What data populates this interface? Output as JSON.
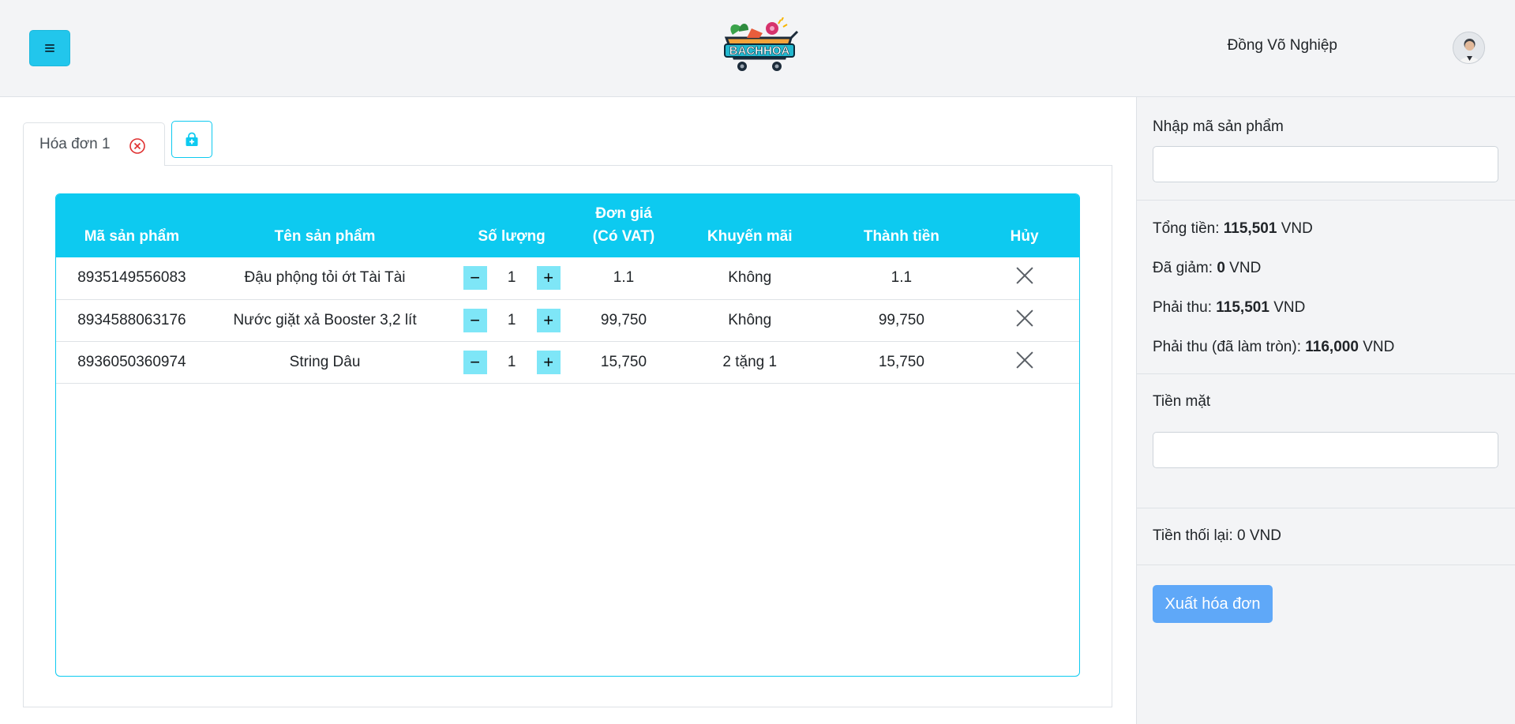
{
  "header": {
    "user_name": "Đồng Võ Nghiệp",
    "logo_text": "BACHHOA"
  },
  "tabs": {
    "active_label": "Hóa đơn 1"
  },
  "table": {
    "headers": {
      "code": "Mã sản phẩm",
      "name": "Tên sản phẩm",
      "qty": "Số lượng",
      "price_line1": "Đơn giá",
      "price_line2": "(Có VAT)",
      "promo": "Khuyến mãi",
      "total": "Thành tiền",
      "cancel": "Hủy"
    },
    "rows": [
      {
        "code": "8935149556083",
        "name": "Đậu phộng tỏi ớt Tài Tài",
        "qty": "1",
        "price": "1.1",
        "promo": "Không",
        "total": "1.1"
      },
      {
        "code": "8934588063176",
        "name": "Nước giặt xả Booster 3,2 lít",
        "qty": "1",
        "price": "99,750",
        "promo": "Không",
        "total": "99,750"
      },
      {
        "code": "8936050360974",
        "name": "String Dâu",
        "qty": "1",
        "price": "15,750",
        "promo": "2 tặng 1",
        "total": "15,750"
      }
    ],
    "minus_symbol": "−",
    "plus_symbol": "+"
  },
  "sidebar": {
    "product_code_label": "Nhập mã sản phẩm",
    "product_code_value": "",
    "summary": {
      "total_label": "Tổng tiền:",
      "total_value": "115,501",
      "discount_label": "Đã giảm:",
      "discount_value": "0",
      "due_label": "Phải thu:",
      "due_value": "115,501",
      "due_rounded_label": "Phải thu (đã làm tròn):",
      "due_rounded_value": "116,000",
      "currency": "VND"
    },
    "cash_label": "Tiền mặt",
    "cash_value": "",
    "change_text": "Tiền thối lại: 0 VND",
    "export_button": "Xuất hóa đơn"
  },
  "colors": {
    "accent": "#0dcaf0",
    "menu_button": "#22c6ec",
    "qty_button": "#7ee6f7",
    "export_button": "#5fa8f8",
    "close_icon": "#e03131",
    "header_bg": "#f3f4f6"
  },
  "icons": {
    "menu": "hamburger-icon",
    "tab_close": "circle-x-icon",
    "add_tab": "shopping-bag-plus-icon",
    "row_delete": "close-icon"
  }
}
